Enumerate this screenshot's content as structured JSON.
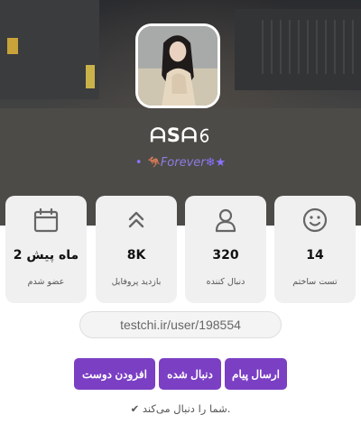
{
  "profile": {
    "username": "ᗩSᗩ𝟼",
    "bio_bullet": "•",
    "bio_emoji": "🦘",
    "bio_text": "Forever",
    "bio_tail": "❄★"
  },
  "stats": [
    {
      "icon": "smiley-icon",
      "value": "14",
      "label": "تست ساختم"
    },
    {
      "icon": "user-icon",
      "value": "320",
      "label": "دنبال کننده"
    },
    {
      "icon": "double-chevron-up-icon",
      "value": "8K",
      "label": "بازدید پروفایل"
    },
    {
      "icon": "calendar-icon",
      "value": "2 ماه پیش",
      "label": "عضو شدم"
    }
  ],
  "profile_url": "testchi.ir/user/198554",
  "actions": {
    "send_message": "ارسال پیام",
    "followed": "دنبال شده",
    "add_friend": "افزودن دوست"
  },
  "follow_note": "✔ شما را دنبال می‌کند.",
  "colors": {
    "accent": "#7b3fc4",
    "bio": "#8f7be0",
    "card_bg": "#f0f0f0"
  }
}
